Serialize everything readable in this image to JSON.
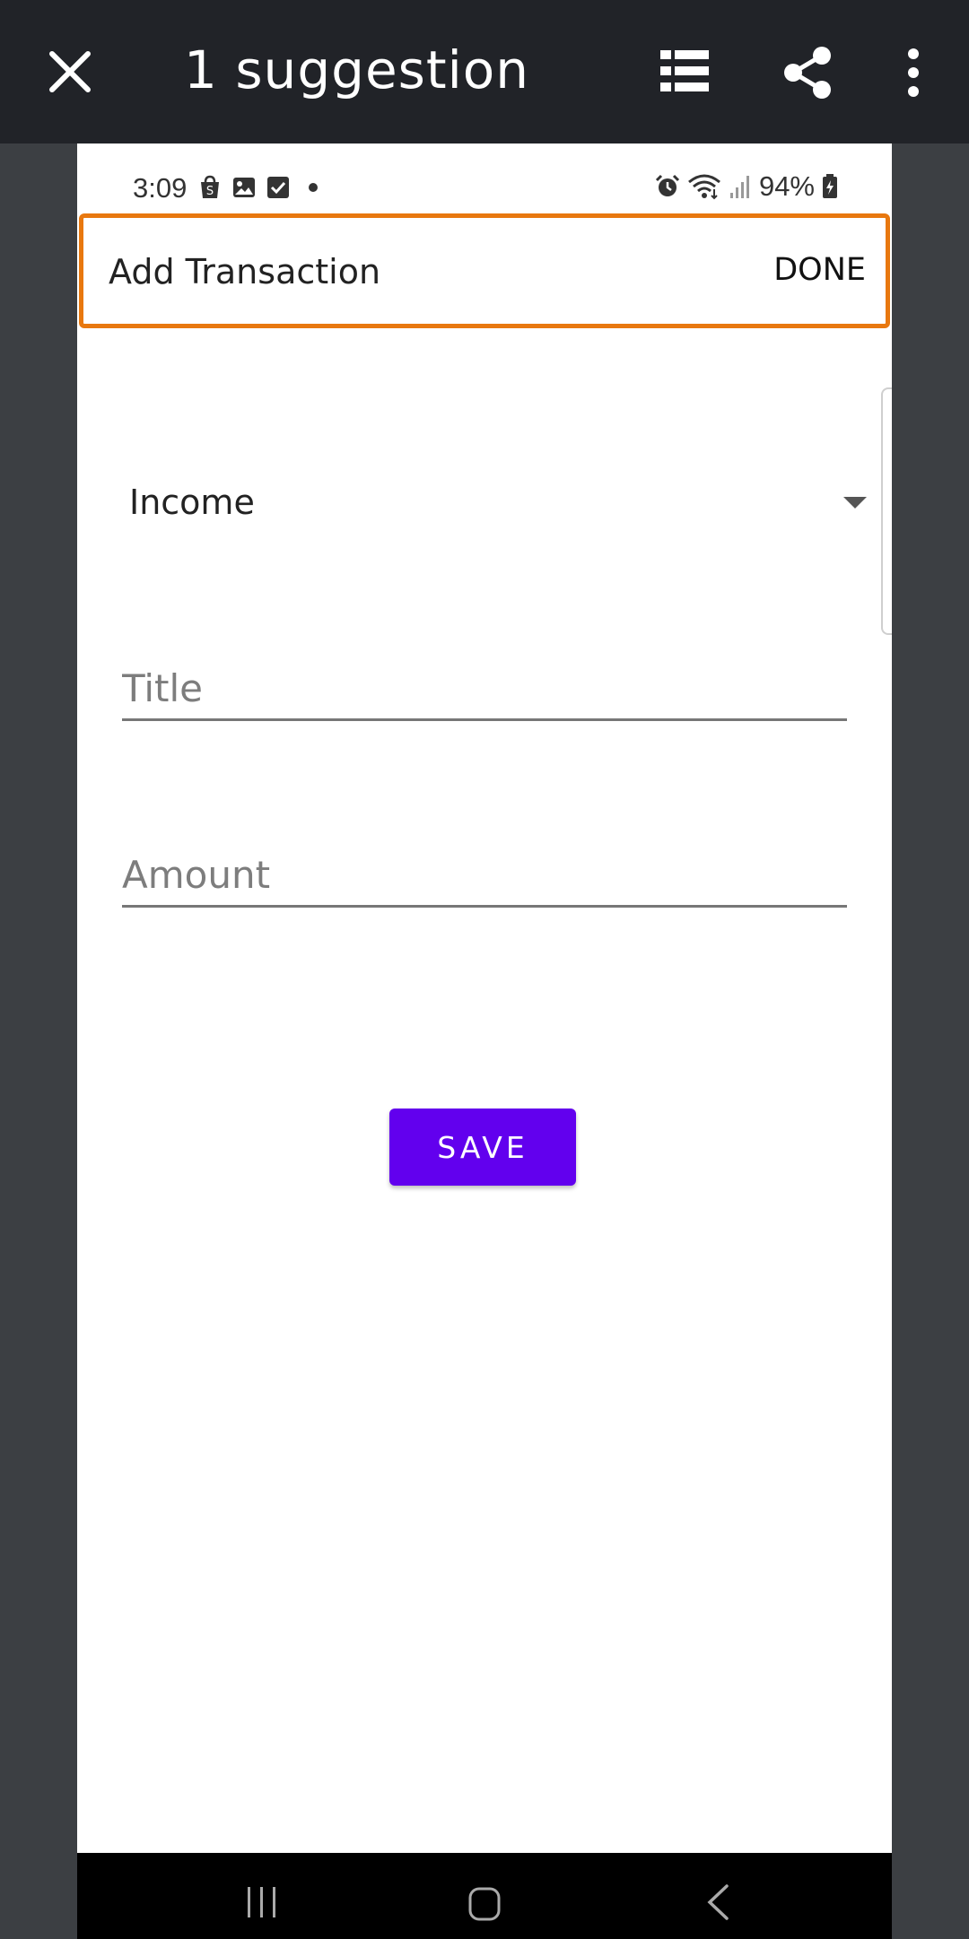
{
  "toolbar": {
    "title": "1 suggestion",
    "close_icon": "close-icon",
    "list_icon": "list-icon",
    "share_icon": "share-icon",
    "more_icon": "more-vert-icon"
  },
  "status_bar": {
    "time": "3:09",
    "battery": "94%",
    "left_icons": [
      "shop-icon",
      "image-icon",
      "checkbox-icon",
      "dot-icon"
    ],
    "right_icons": [
      "alarm-icon",
      "wifi-icon",
      "signal-icon",
      "battery-icon"
    ]
  },
  "app_bar": {
    "title": "Add Transaction",
    "done_label": "DONE"
  },
  "form": {
    "type_selected": "Income",
    "title_placeholder": "Title",
    "amount_placeholder": "Amount",
    "save_label": "SAVE"
  },
  "colors": {
    "toolbar_bg": "#212328",
    "highlight_border": "#e8780f",
    "save_button": "#6200ee",
    "backdrop": "#3c3f43"
  },
  "nav_bar": {
    "icons": [
      "recents-icon",
      "home-icon",
      "back-icon"
    ]
  }
}
